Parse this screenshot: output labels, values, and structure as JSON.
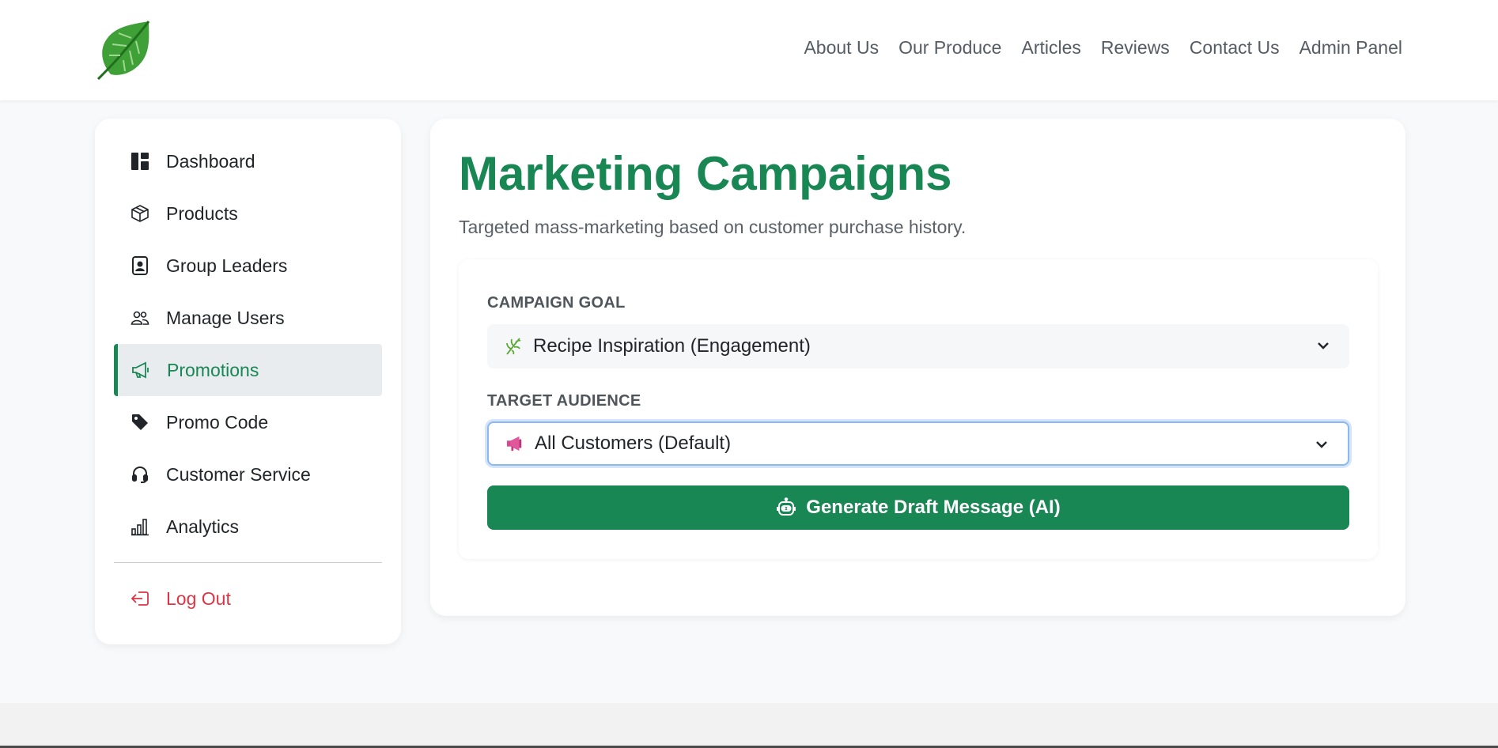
{
  "nav": {
    "links": [
      "About Us",
      "Our Produce",
      "Articles",
      "Reviews",
      "Contact Us",
      "Admin Panel"
    ]
  },
  "sidebar": {
    "items": [
      {
        "label": "Dashboard",
        "icon": "dashboard-icon"
      },
      {
        "label": "Products",
        "icon": "box-icon"
      },
      {
        "label": "Group Leaders",
        "icon": "person-badge-icon"
      },
      {
        "label": "Manage Users",
        "icon": "people-icon"
      },
      {
        "label": "Promotions",
        "icon": "megaphone-icon",
        "active": true
      },
      {
        "label": "Promo Code",
        "icon": "tag-icon"
      },
      {
        "label": "Customer Service",
        "icon": "headset-icon"
      },
      {
        "label": "Analytics",
        "icon": "bar-chart-icon"
      }
    ],
    "logout_label": "Log Out"
  },
  "main": {
    "title": "Marketing Campaigns",
    "subtitle": "Targeted mass-marketing based on customer purchase history.",
    "campaign_goal_label": "CAMPAIGN GOAL",
    "campaign_goal_value": "Recipe Inspiration (Engagement)",
    "target_audience_label": "TARGET AUDIENCE",
    "target_audience_value": "All Customers (Default)",
    "generate_button_label": "Generate Draft Message (AI)"
  },
  "colors": {
    "brand": "#198754",
    "danger": "#dc3545",
    "active_bg": "#e8ecef"
  }
}
